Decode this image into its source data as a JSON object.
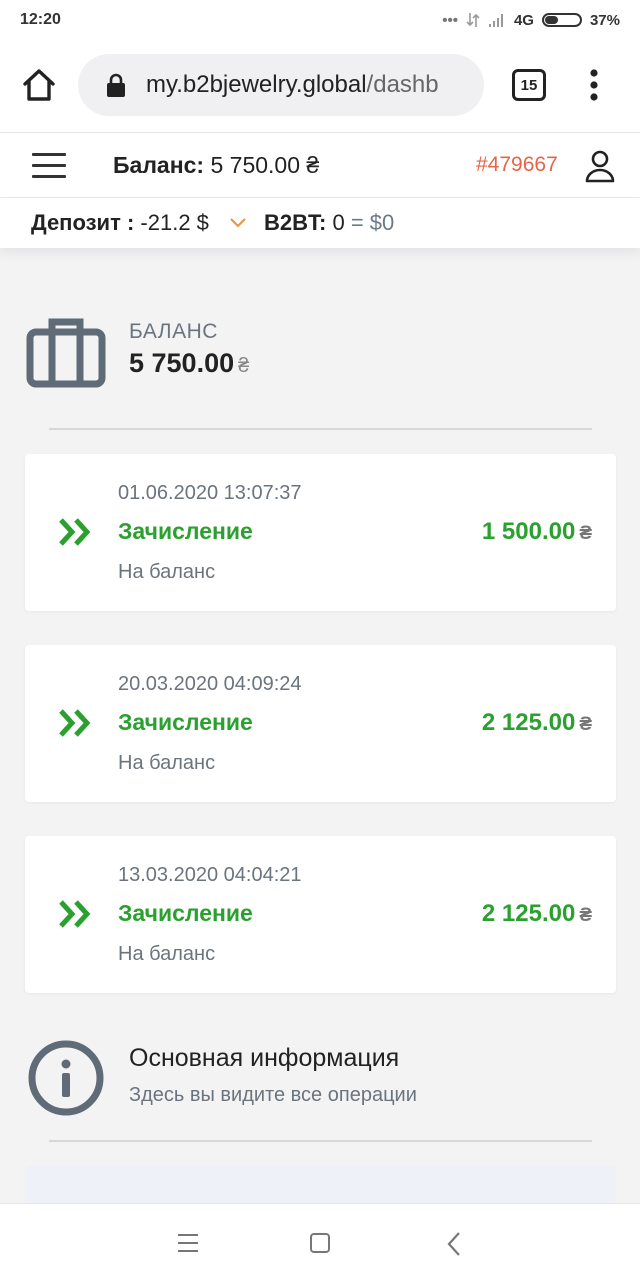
{
  "status_bar": {
    "time": "12:20",
    "signal_text": "... ",
    "network": "4G",
    "battery": "37%",
    "battery_level": 0.37
  },
  "browser": {
    "url_host": "my.b2bjewelry.global",
    "url_path": "/dashb",
    "tab_count": "15",
    "icons": [
      "home-icon",
      "lock-icon",
      "tabs-icon",
      "more-vert-icon"
    ]
  },
  "header": {
    "balance_label": "Баланс:",
    "balance_value": " 5 750.00 ₴",
    "account_id": "#479667",
    "icons": [
      "hamburger-icon",
      "user-icon"
    ]
  },
  "deposit_bar": {
    "deposit_label": "Депозит :",
    "deposit_value": " -21.2 $",
    "token_label": "B2BT:",
    "token_value": " 0",
    "token_eq": " = $0",
    "caret_color": "#e8964a"
  },
  "balance_card": {
    "label": "БАЛАНС",
    "value": "5 750.00",
    "currency": "₴",
    "icon": "wallet-icon"
  },
  "transactions": [
    {
      "date": "01.06.2020 13:07:37",
      "type": "Зачисление",
      "description": "На баланс",
      "amount": "1 500.00",
      "currency": "₴"
    },
    {
      "date": "20.03.2020 04:09:24",
      "type": "Зачисление",
      "description": "На баланс",
      "amount": "2 125.00",
      "currency": "₴"
    },
    {
      "date": "13.03.2020 04:04:21",
      "type": "Зачисление",
      "description": "На баланс",
      "amount": "2 125.00",
      "currency": "₴"
    }
  ],
  "info": {
    "title": "Основная информация",
    "subtitle": "Здесь вы видите все операции",
    "icon": "info-icon"
  },
  "colors": {
    "accent_green": "#2aa12f",
    "account_orange": "#e6654a",
    "muted_gray": "#6b747e"
  }
}
